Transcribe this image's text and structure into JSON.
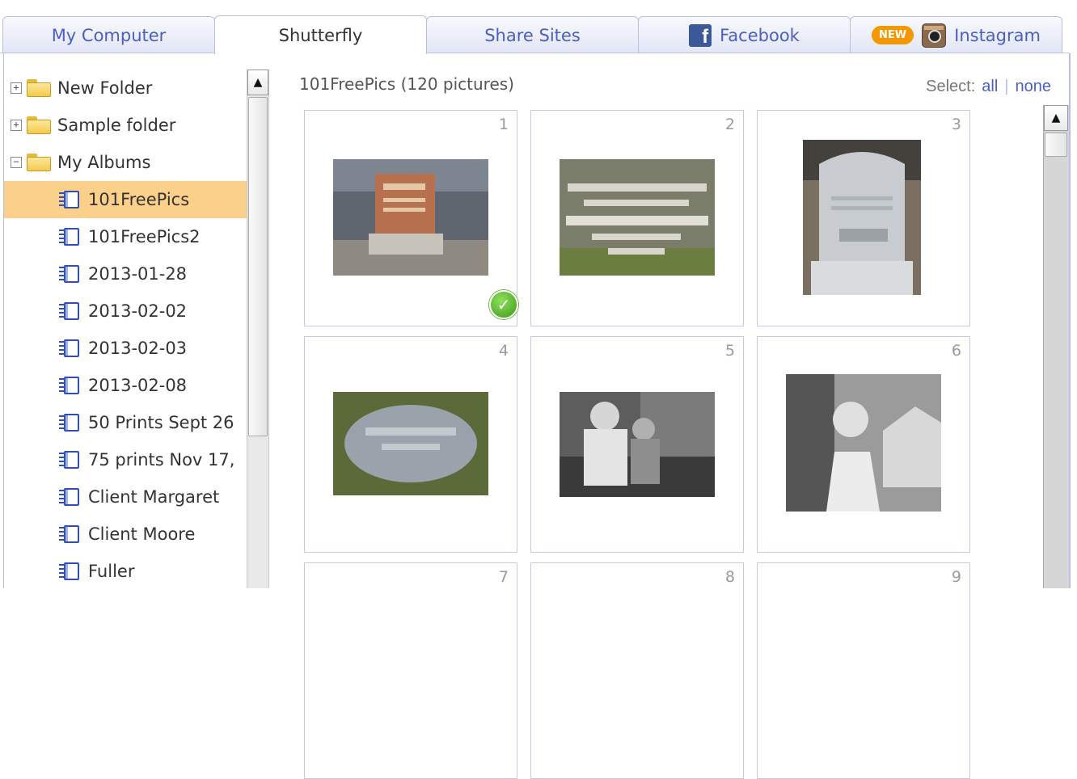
{
  "tabs": [
    {
      "label": "My Computer"
    },
    {
      "label": "Shutterfly"
    },
    {
      "label": "Share Sites"
    },
    {
      "label": "Facebook"
    },
    {
      "label": "Instagram",
      "badge": "NEW"
    }
  ],
  "tree": {
    "folders": [
      "New Folder",
      "Sample folder",
      "My Albums"
    ],
    "albums": [
      "101FreePics",
      "101FreePics2",
      "2013-01-28",
      "2013-02-02",
      "2013-02-03",
      "2013-02-08",
      "50 Prints Sept 26",
      "75 prints Nov 17,",
      "Client Margaret",
      "Client Moore",
      "Fuller"
    ],
    "selected": "101FreePics"
  },
  "album": {
    "title": "101FreePics (120 pictures)",
    "select_label": "Select:",
    "select_all": "all",
    "select_none": "none"
  },
  "photos": [
    {
      "num": "1",
      "selected": true
    },
    {
      "num": "2"
    },
    {
      "num": "3"
    },
    {
      "num": "4"
    },
    {
      "num": "5"
    },
    {
      "num": "6"
    },
    {
      "num": "7"
    },
    {
      "num": "8"
    },
    {
      "num": "9"
    }
  ],
  "colors": {
    "accent": "#4b5fc2",
    "selection": "#fbd08a",
    "border": "#b9bfe0"
  }
}
